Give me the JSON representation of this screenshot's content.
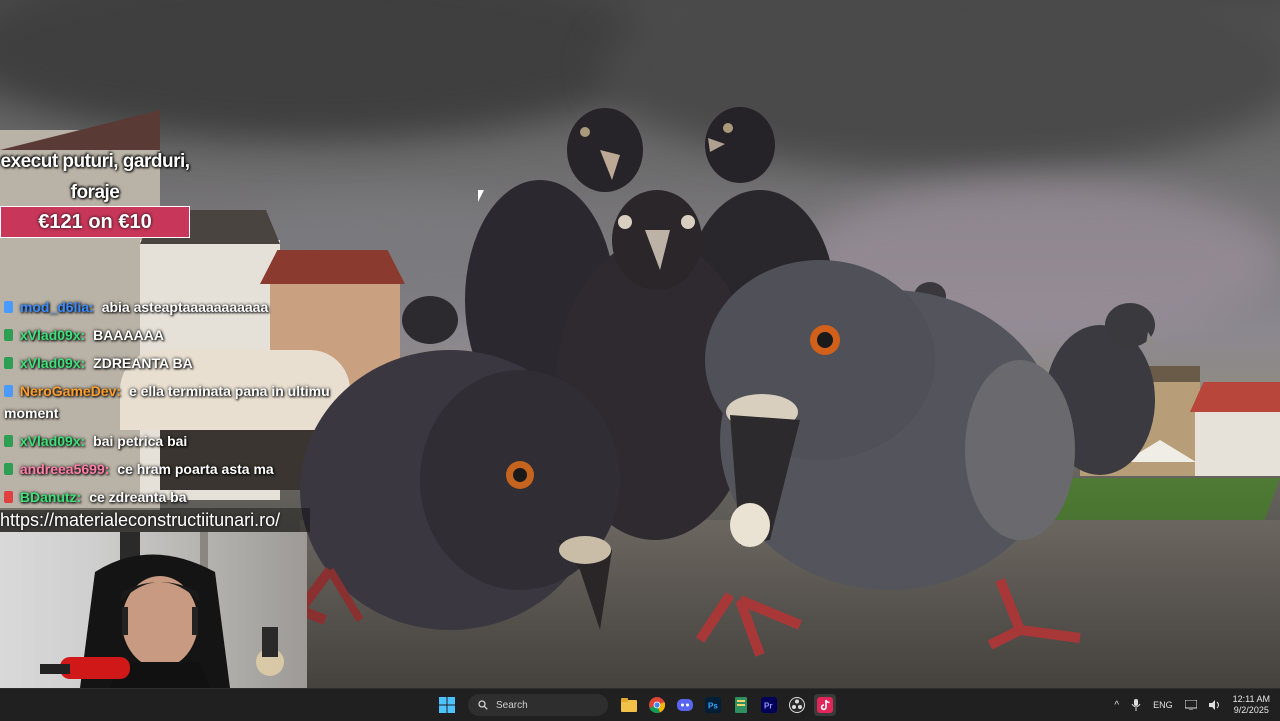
{
  "promo": {
    "line1": "execut puturi, garduri,",
    "line2": "foraje",
    "price": "€121 on €10"
  },
  "chat": {
    "messages": [
      {
        "user": "mod_d6lia:",
        "text": "abia asteaptaaaaaaaaaaa",
        "color": "#3b8dff"
      },
      {
        "user": "xVlad09x:",
        "text": "BAAAAAA",
        "color": "#3ee07a"
      },
      {
        "user": "xVlad09x:",
        "text": "ZDREANTA BA",
        "color": "#3ee07a"
      },
      {
        "user": "NeroGameDev:",
        "text": "e ella terminata pana in ultimu moment",
        "color": "#ff9e2c"
      },
      {
        "user": "xVlad09x:",
        "text": "bai petrica bai",
        "color": "#3ee07a"
      },
      {
        "user": "andreea5699:",
        "text": "ce hram poarta asta ma",
        "color": "#ff7fa8"
      },
      {
        "user": "BDanutz:",
        "text": "ce zdreanta ba",
        "color": "#3ee07a"
      }
    ]
  },
  "overlay": {
    "url": "https://materialeconstructiitunari.ro/"
  },
  "taskbar": {
    "search_label": "Search",
    "language": "ENG",
    "time": "12:11 AM",
    "date": "9/2/2025"
  },
  "colors": {
    "promo_bg": "#c8375a",
    "taskbar_bg": "#202020"
  }
}
